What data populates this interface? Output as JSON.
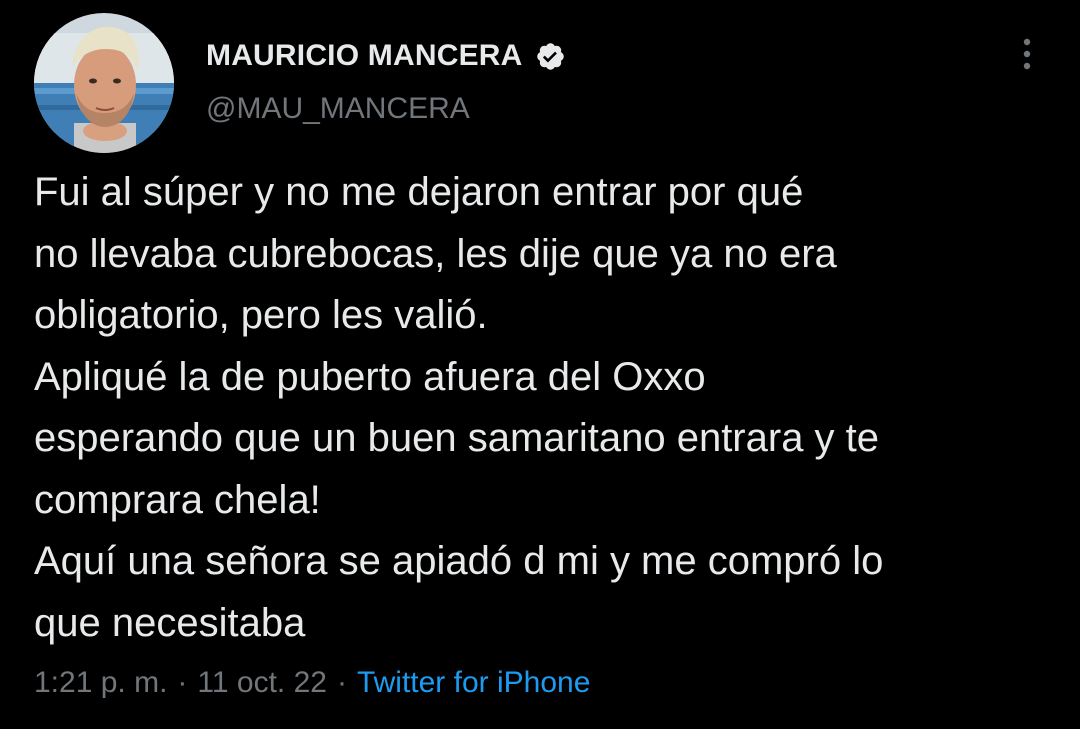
{
  "tweet": {
    "author": {
      "display_name": "MAURICIO MANCERA",
      "handle": "@MAU_MANCERA",
      "verified": true,
      "avatar_icon": "user-avatar"
    },
    "body_lines": [
      "Fui al súper y no me dejaron entrar por qué",
      "no llevaba cubrebocas, les dije que ya no era",
      "obligatorio, pero les valió.",
      "Apliqué la de puberto afuera del Oxxo",
      "esperando que un buen samaritano entrara y te",
      "comprara chela!",
      "Aquí una señora se apiadó d mi y me compró lo",
      "que necesitaba"
    ],
    "meta": {
      "time": "1:21 p. m.",
      "separator": "·",
      "date": "11 oct. 22",
      "source": "Twitter for iPhone"
    },
    "more_icon": "more-vertical-icon"
  },
  "colors": {
    "background": "#000000",
    "text_primary": "#e7e9ea",
    "text_secondary": "#71767b",
    "link": "#1d9bf0"
  }
}
